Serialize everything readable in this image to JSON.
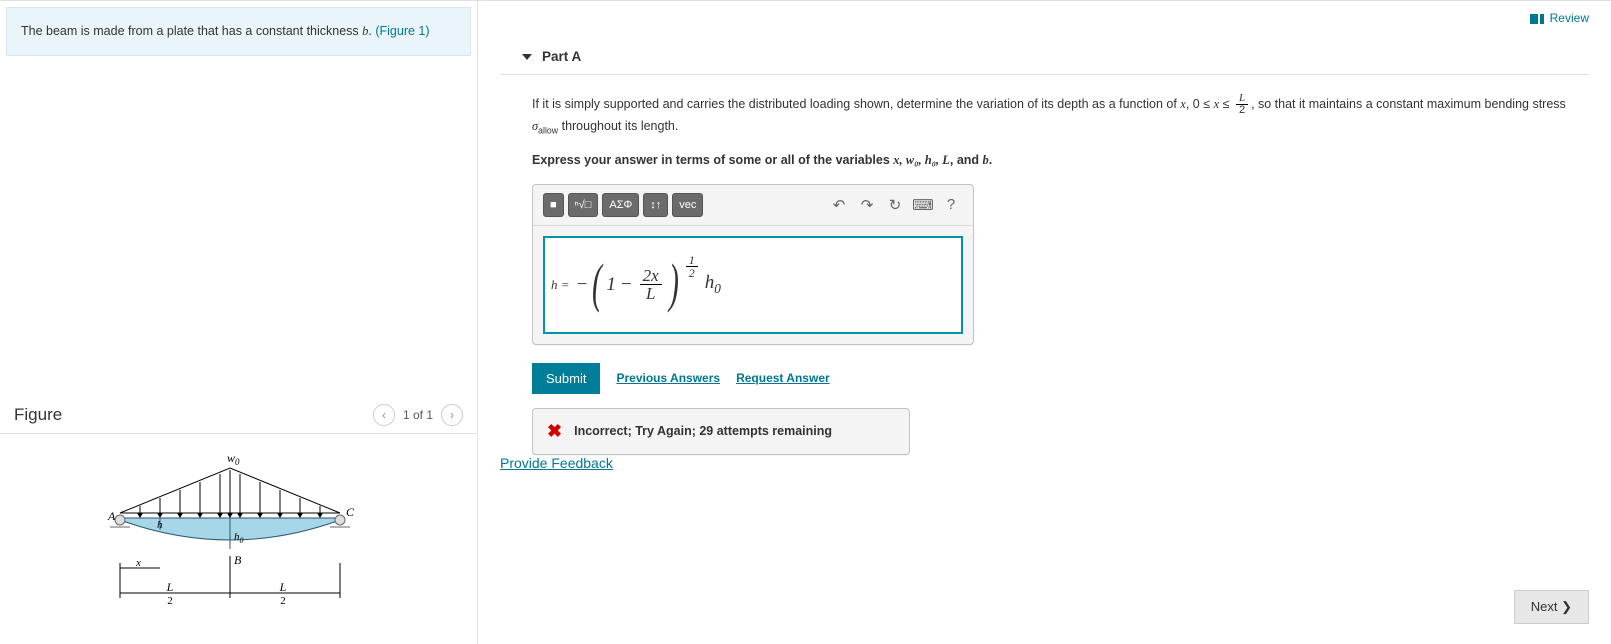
{
  "header": {
    "review": "Review"
  },
  "intro": {
    "text_before": "The beam is made from a plate that has a constant thickness ",
    "var_b": "b",
    "text_after": ". ",
    "fig_ref": "(Figure 1)"
  },
  "figure": {
    "title": "Figure",
    "pager": "1 of 1",
    "labels": {
      "w0": "w",
      "A": "A",
      "B": "B",
      "C": "C",
      "h": "h",
      "h0": "h",
      "x": "x",
      "Lhalf_n": "L",
      "Lhalf_d": "2"
    }
  },
  "part": {
    "title": "Part A",
    "question": {
      "p1": "If it is simply supported and carries the distributed loading shown, determine the variation of its depth as a function of ",
      "xvar": "x",
      "p2": ", ",
      "range_start": "0 ≤ ",
      "range_x": "x",
      "range_mid": " ≤ ",
      "frac_n": "L",
      "frac_d": "2",
      "p3": ", so that it maintains a constant maximum bending stress ",
      "sigma": "σ",
      "sigma_sub": "allow",
      "p4": " throughout its length."
    },
    "instruction": {
      "t1": "Express your answer in terms of some or all of the variables ",
      "vars": "x, w₀, h₀, L",
      "t2": ", and ",
      "last": "b",
      "t3": "."
    },
    "toolbar": {
      "tmpl": "■",
      "root": "ⁿ√□",
      "greek": "ΑΣΦ",
      "arrows": "↕↑",
      "vec": "vec",
      "undo": "↶",
      "redo": "↷",
      "reset": "↻",
      "kbd": "⌨",
      "help": "?"
    },
    "equation": {
      "lhs": "h =",
      "neg": "−",
      "one": "1",
      "minus2": "−",
      "num": "2x",
      "den": "L",
      "exp_n": "1",
      "exp_d": "2",
      "h0": "h",
      "h0_sub": "0"
    },
    "submit": "Submit",
    "prev_answers": "Previous Answers",
    "request": "Request Answer",
    "error": "Incorrect; Try Again; 29 attempts remaining"
  },
  "feedback": "Provide Feedback",
  "next": "Next ❯"
}
